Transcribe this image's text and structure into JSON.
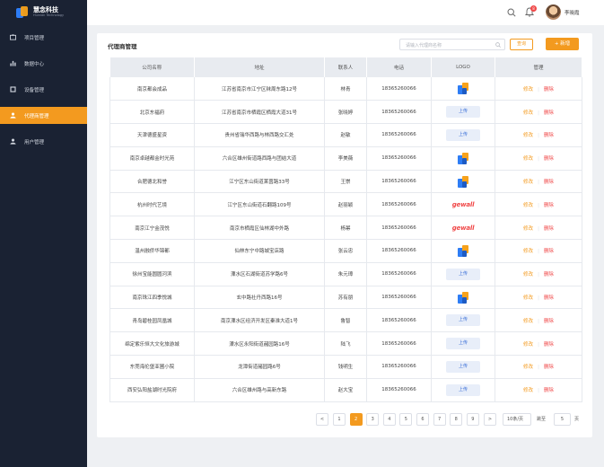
{
  "app": {
    "name": "慧念科技",
    "subtitle": "Huinian Technology"
  },
  "sidebar": {
    "items": [
      {
        "label": "项目管理",
        "icon": "project-icon"
      },
      {
        "label": "数据中心",
        "icon": "chart-icon"
      },
      {
        "label": "设备管理",
        "icon": "device-icon"
      },
      {
        "label": "代理商管理",
        "icon": "agent-icon",
        "active": true
      },
      {
        "label": "用户管理",
        "icon": "user-icon"
      }
    ]
  },
  "topbar": {
    "username": "李晓霞",
    "badge": "8"
  },
  "page": {
    "title": "代理商管理",
    "search_placeholder": "请输入代理商名称",
    "query_label": "查询",
    "add_label": "+ 新增"
  },
  "table": {
    "headers": [
      "公司名称",
      "地址",
      "联系人",
      "电话",
      "LOGO",
      "管理"
    ],
    "edit_label": "修改",
    "delete_label": "删除",
    "upload_label": "上传",
    "rows": [
      {
        "company": "南京都会成品",
        "address": "江苏省南京市江宁区秣周东路12号",
        "contact": "林青",
        "phone": "18365260066",
        "logo": "brand"
      },
      {
        "company": "北京东福府",
        "address": "江苏省南京市栖霞区栖霞大道31号",
        "contact": "张晓婷",
        "phone": "18365260066",
        "logo": "upload"
      },
      {
        "company": "天津德盛星资",
        "address": "贵州省瑞华西路与林西路交汇处",
        "contact": "赵敏",
        "phone": "18365260066",
        "logo": "upload"
      },
      {
        "company": "南京卓越都金时光苑",
        "address": "六合区雄州街道路西路与团结大道",
        "contact": "李美薇",
        "phone": "18365260066",
        "logo": "brand"
      },
      {
        "company": "合肥德北和誉",
        "address": "江宁区东山街道莱茵路33号",
        "contact": "王崇",
        "phone": "18365260066",
        "logo": "brand"
      },
      {
        "company": "杭州时代艺境",
        "address": "江宁区东山街道石翻路109号",
        "contact": "赵丽颖",
        "phone": "18365260066",
        "logo": "gewall"
      },
      {
        "company": "南京江宁金茂悦",
        "address": "南京市栖霞区仙林湖中外路",
        "contact": "杨幂",
        "phone": "18365260066",
        "logo": "gewall"
      },
      {
        "company": "温州融侨华锦都",
        "address": "仙林东宁中路城宝店路",
        "contact": "张云忠",
        "phone": "18365260066",
        "logo": "brand"
      },
      {
        "company": "徐州宝能圆圆河滨",
        "address": "溧水区石湖街道苏学路6号",
        "contact": "朱元璋",
        "phone": "18365260066",
        "logo": "upload"
      },
      {
        "company": "南京珠江四季悦城",
        "address": "玄中路社丹西路16号",
        "contact": "苏有朋",
        "phone": "18365260066",
        "logo": "brand"
      },
      {
        "company": "青岛碧桂园凤凰城",
        "address": "南京溧水区经济开发区秦淮大道1号",
        "contact": "鲁智",
        "phone": "18365260066",
        "logo": "upload"
      },
      {
        "company": "绵定紫乐恒大文化旅游城",
        "address": "溧水区永阳街道赭园路16号",
        "contact": "陆飞",
        "phone": "18365260066",
        "logo": "upload"
      },
      {
        "company": "东莞海伦堡亚圃小院",
        "address": "龙潭街道赭园路6号",
        "contact": "钱明生",
        "phone": "18365260066",
        "logo": "upload"
      },
      {
        "company": "西安弘阳盐湖时光院府",
        "address": "六合区雄州路与高新东路",
        "contact": "赵大宝",
        "phone": "18365260066",
        "logo": "upload"
      }
    ]
  },
  "pager": {
    "pages": [
      "1",
      "2",
      "3",
      "4",
      "5",
      "6",
      "7",
      "8",
      "9"
    ],
    "current": "2",
    "prev": "<",
    "next": ">",
    "page_size": "10条/页",
    "jump_label": "跳至",
    "jump_value": "5",
    "page_suffix": "页"
  },
  "colors": {
    "accent": "#f39a1f",
    "sidebar": "#1a2233",
    "danger": "#f04848"
  }
}
